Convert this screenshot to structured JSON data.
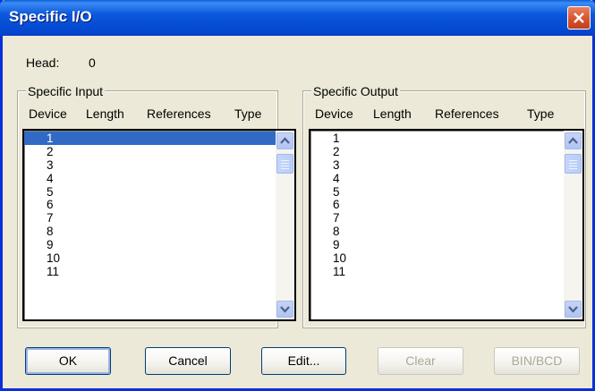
{
  "window": {
    "title": "Specific I/O"
  },
  "head": {
    "label": "Head:",
    "value": "0"
  },
  "input": {
    "group_title": "Specific Input",
    "columns": [
      "Device",
      "Length",
      "References",
      "Type"
    ],
    "rows": [
      "1",
      "2",
      "3",
      "4",
      "5",
      "6",
      "7",
      "8",
      "9",
      "10",
      "11"
    ],
    "selected": "1"
  },
  "output": {
    "group_title": "Specific Output",
    "columns": [
      "Device",
      "Length",
      "References",
      "Type"
    ],
    "rows": [
      "1",
      "2",
      "3",
      "4",
      "5",
      "6",
      "7",
      "8",
      "9",
      "10",
      "11"
    ]
  },
  "buttons": {
    "ok": "OK",
    "cancel": "Cancel",
    "edit": "Edit...",
    "clear": "Clear",
    "binbcd": "BIN/BCD"
  },
  "colors": {
    "titlebar": "#0a58dc",
    "selection": "#316ac5",
    "close": "#d4502a",
    "face": "#ece9d8"
  },
  "icons": [
    "close-icon",
    "scroll-up-icon",
    "scroll-down-icon"
  ]
}
